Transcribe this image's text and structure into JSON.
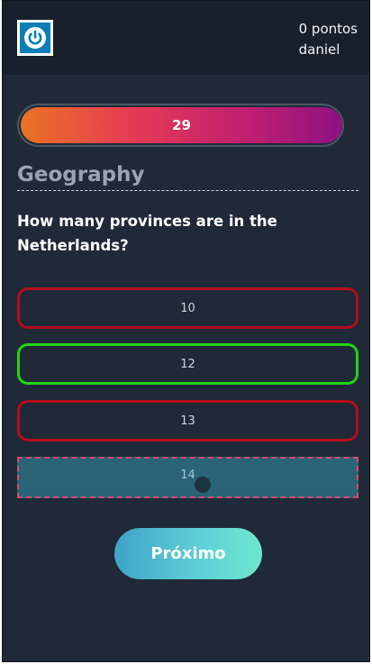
{
  "header": {
    "logo_icon": "power-icon",
    "points": "0 pontos",
    "username": "daniel"
  },
  "timer": {
    "value": "29",
    "fill_fraction": 1.0,
    "colors": [
      "#ea7324",
      "#e53a55",
      "#8e1280"
    ]
  },
  "quiz": {
    "category": "Geography",
    "question": "How many provinces are in the Netherlands?",
    "answers": [
      {
        "label": "10",
        "state": "wrong"
      },
      {
        "label": "12",
        "state": "correct"
      },
      {
        "label": "13",
        "state": "wrong"
      },
      {
        "label": "14",
        "state": "selected"
      }
    ]
  },
  "actions": {
    "next_label": "Próximo"
  },
  "colors": {
    "background": "#1f2937",
    "correct": "#22d40f",
    "wrong": "#b50d1c",
    "accent": "#5fd1d6"
  }
}
